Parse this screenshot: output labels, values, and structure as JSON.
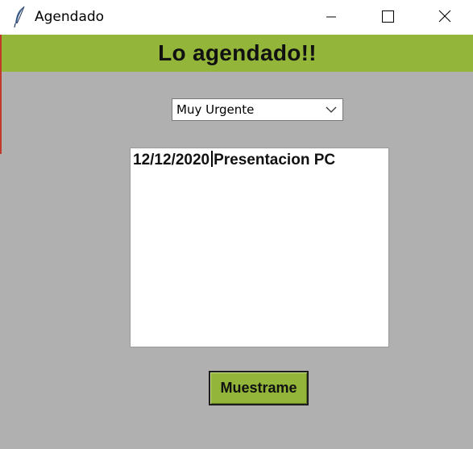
{
  "window": {
    "title": "Agendado",
    "icon": "feather-icon"
  },
  "window_controls": {
    "minimize_icon": "minimize-icon",
    "maximize_icon": "maximize-icon",
    "close_icon": "close-icon"
  },
  "header": {
    "title": "Lo agendado!!"
  },
  "priority_select": {
    "selected": "Muy Urgente"
  },
  "agenda_text": {
    "date": "12/12/2020",
    "entry": "Presentacion PC"
  },
  "actions": {
    "show_label": "Muestrame"
  },
  "colors": {
    "banner": "#92b53a",
    "background": "#b0b0b0",
    "button": "#92b53a"
  }
}
